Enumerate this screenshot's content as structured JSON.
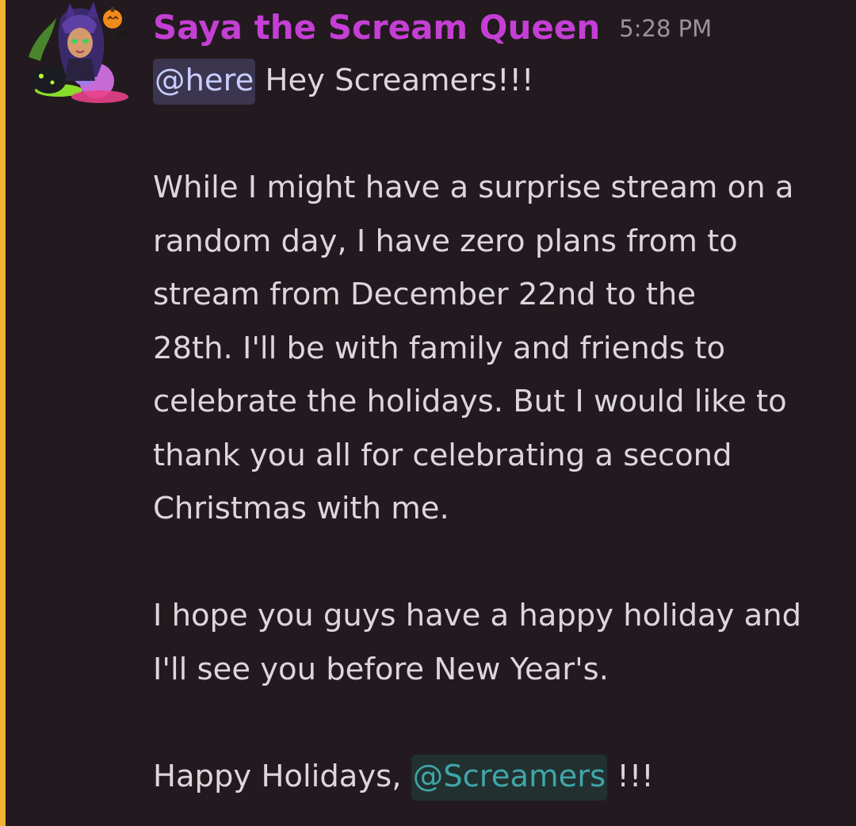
{
  "message": {
    "username": "Saya the Scream Queen",
    "timestamp": "5:28 PM",
    "username_color": "#c43fd4",
    "highlight_bar_color": "#f0b232",
    "avatar_icon": "witch-avatar-icon",
    "first_line": {
      "mention": "@here",
      "text": " Hey Screamers!!!"
    },
    "paragraph_1": [
      "While I might have a surprise stream on a",
      "random day, I have zero plans from to",
      "stream from December 22nd to the",
      "28th. I'll be with family and friends to",
      "celebrate the holidays. But I would like to",
      "thank you all for celebrating a second",
      "Christmas with me."
    ],
    "paragraph_2": [
      "I hope you guys have a happy holiday and",
      "I'll see you before New Year's."
    ],
    "closing": {
      "prefix": "Happy Holidays, ",
      "mention": "@Screamers",
      "suffix": " !!!"
    }
  }
}
